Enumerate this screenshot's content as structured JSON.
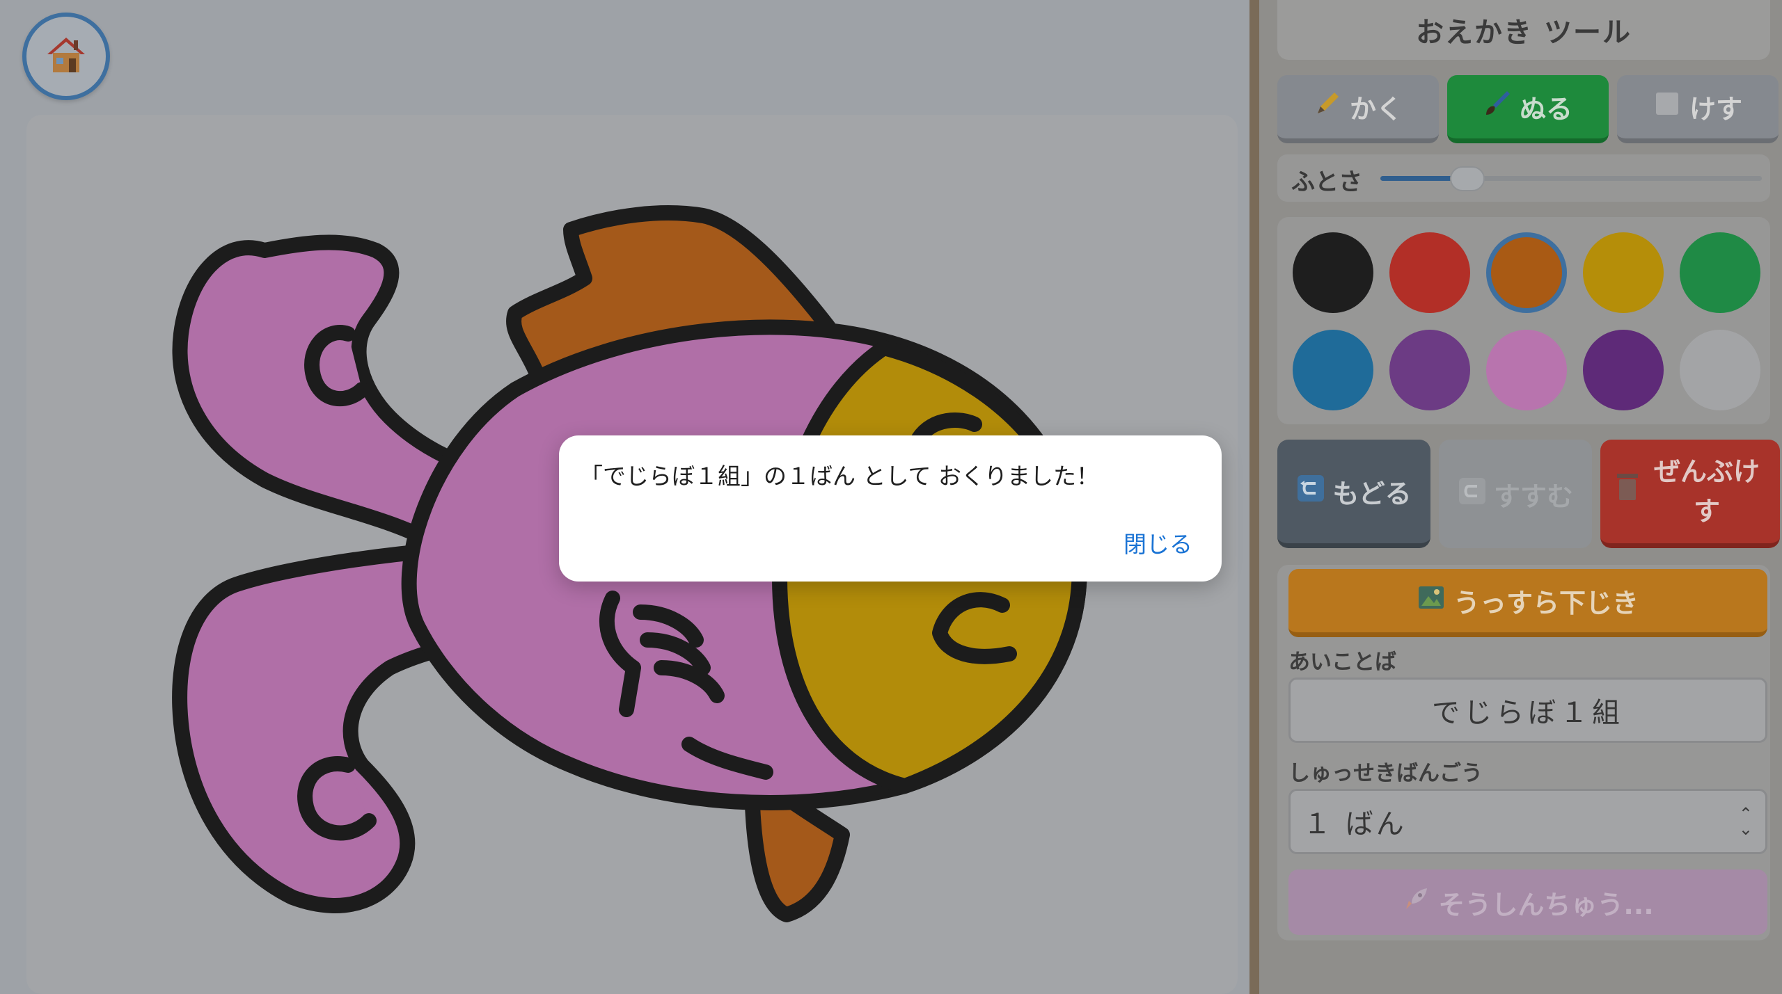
{
  "home": {
    "icon": "house-icon"
  },
  "panel": {
    "title": "おえかき ツール",
    "modes": [
      {
        "label": "かく",
        "icon": "pencil-icon",
        "active": false
      },
      {
        "label": "ぬる",
        "icon": "brush-icon",
        "active": true
      },
      {
        "label": "けす",
        "icon": "eraser-icon",
        "active": false
      }
    ],
    "thickness": {
      "label": "ふとさ",
      "value_fraction": 0.2
    },
    "colors": [
      "#1e1e1e",
      "#b22f27",
      "#a95a14",
      "#b58e09",
      "#1f8a45",
      "#1f6b99",
      "#6c3b84",
      "#b874ae",
      "#5e2a78",
      "#a3a4a6"
    ],
    "selected_color_index": 2,
    "actions": {
      "undo_label": "もどる",
      "redo_label": "すすむ",
      "clear_label": "ぜんぶけす"
    },
    "trace_label": "うっすら下じき",
    "password": {
      "label": "あいことば",
      "value": "でじらぼ１組"
    },
    "seat": {
      "label": "しゅっせきばんごう",
      "value": "１ ばん"
    },
    "send_label": "そうしんちゅう..."
  },
  "dialog": {
    "message": "「でじらぼ１組」の１ばん として おくりました！",
    "close_label": "閉じる"
  }
}
